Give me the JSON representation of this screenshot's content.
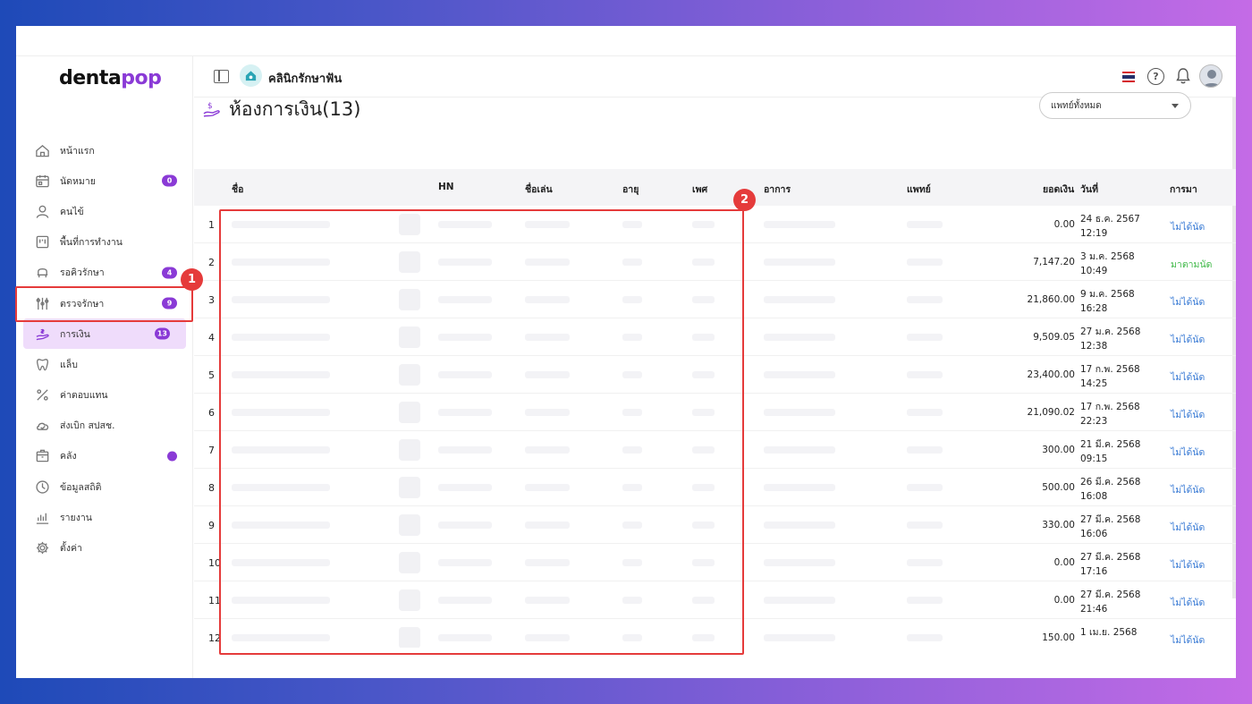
{
  "app": {
    "logo_text_main": "denta",
    "logo_text_accent": "pop",
    "brand_color": "#8a3ad6"
  },
  "header": {
    "clinic_name": "คลินิกรักษาฟัน",
    "flag": "thai-flag-icon",
    "help_glyph": "?"
  },
  "sidebar": {
    "items": [
      {
        "label": "หน้าแรก",
        "icon": "home-icon"
      },
      {
        "label": "นัดหมาย",
        "icon": "calendar-icon",
        "badge": "0"
      },
      {
        "label": "คนไข้",
        "icon": "user-icon"
      },
      {
        "label": "พื้นที่การทำงาน",
        "icon": "workspace-icon"
      },
      {
        "label": "รอคิวรักษา",
        "icon": "dental-chair-icon",
        "badge": "4"
      },
      {
        "label": "ตรวจรักษา",
        "icon": "tools-icon",
        "badge": "9"
      },
      {
        "label": "การเงิน",
        "icon": "payment-icon",
        "badge": "13",
        "active": true
      },
      {
        "label": "แล็บ",
        "icon": "tooth-icon"
      },
      {
        "label": "ค่าตอบแทน",
        "icon": "percent-icon"
      },
      {
        "label": "ส่งเบิก สปสช.",
        "icon": "cloud-icon"
      },
      {
        "label": "คลัง",
        "icon": "box-icon",
        "dot": true
      },
      {
        "label": "ข้อมูลสถิติ",
        "icon": "stats-icon"
      },
      {
        "label": "รายงาน",
        "icon": "report-icon"
      },
      {
        "label": "ตั้งค่า",
        "icon": "gear-icon"
      }
    ]
  },
  "page": {
    "title": "ห้องการเงิน(13)",
    "doctor_filter": "แพทย์ทั้งหมด"
  },
  "table": {
    "headers": {
      "name": "ชื่อ",
      "hn": "HN",
      "nickname": "ชื่อเล่น",
      "age": "อายุ",
      "sex": "เพศ",
      "symptom": "อาการ",
      "doctor": "แพทย์",
      "amount": "ยอดเงิน",
      "date": "วันที่",
      "visit": "การมา"
    },
    "rows": [
      {
        "no": "1",
        "amount": "0.00",
        "date1": "24 ธ.ค. 2567",
        "date2": "12:19",
        "status": "ไม่ได้นัด",
        "status_type": "blue"
      },
      {
        "no": "2",
        "amount": "7,147.20",
        "date1": "3 ม.ค. 2568",
        "date2": "10:49",
        "status": "มาตามนัด",
        "status_type": "green"
      },
      {
        "no": "3",
        "amount": "21,860.00",
        "date1": "9 ม.ค. 2568",
        "date2": "16:28",
        "status": "ไม่ได้นัด",
        "status_type": "blue"
      },
      {
        "no": "4",
        "amount": "9,509.05",
        "date1": "27 ม.ค. 2568",
        "date2": "12:38",
        "status": "ไม่ได้นัด",
        "status_type": "blue"
      },
      {
        "no": "5",
        "amount": "23,400.00",
        "date1": "17 ก.พ. 2568",
        "date2": "14:25",
        "status": "ไม่ได้นัด",
        "status_type": "blue"
      },
      {
        "no": "6",
        "amount": "21,090.02",
        "date1": "17 ก.พ. 2568",
        "date2": "22:23",
        "status": "ไม่ได้นัด",
        "status_type": "blue"
      },
      {
        "no": "7",
        "amount": "300.00",
        "date1": "21 มี.ค. 2568",
        "date2": "09:15",
        "status": "ไม่ได้นัด",
        "status_type": "blue"
      },
      {
        "no": "8",
        "amount": "500.00",
        "date1": "26 มี.ค. 2568",
        "date2": "16:08",
        "status": "ไม่ได้นัด",
        "status_type": "blue"
      },
      {
        "no": "9",
        "amount": "330.00",
        "date1": "27 มี.ค. 2568",
        "date2": "16:06",
        "status": "ไม่ได้นัด",
        "status_type": "blue"
      },
      {
        "no": "10",
        "amount": "0.00",
        "date1": "27 มี.ค. 2568",
        "date2": "17:16",
        "status": "ไม่ได้นัด",
        "status_type": "blue"
      },
      {
        "no": "11",
        "amount": "0.00",
        "date1": "27 มี.ค. 2568",
        "date2": "21:46",
        "status": "ไม่ได้นัด",
        "status_type": "blue"
      },
      {
        "no": "12",
        "amount": "150.00",
        "date1": "1 เม.ย. 2568",
        "date2": "",
        "status": "ไม่ได้นัด",
        "status_type": "blue"
      }
    ]
  },
  "annotations": {
    "mark1": "1",
    "mark2": "2",
    "color": "#e53b3b"
  }
}
